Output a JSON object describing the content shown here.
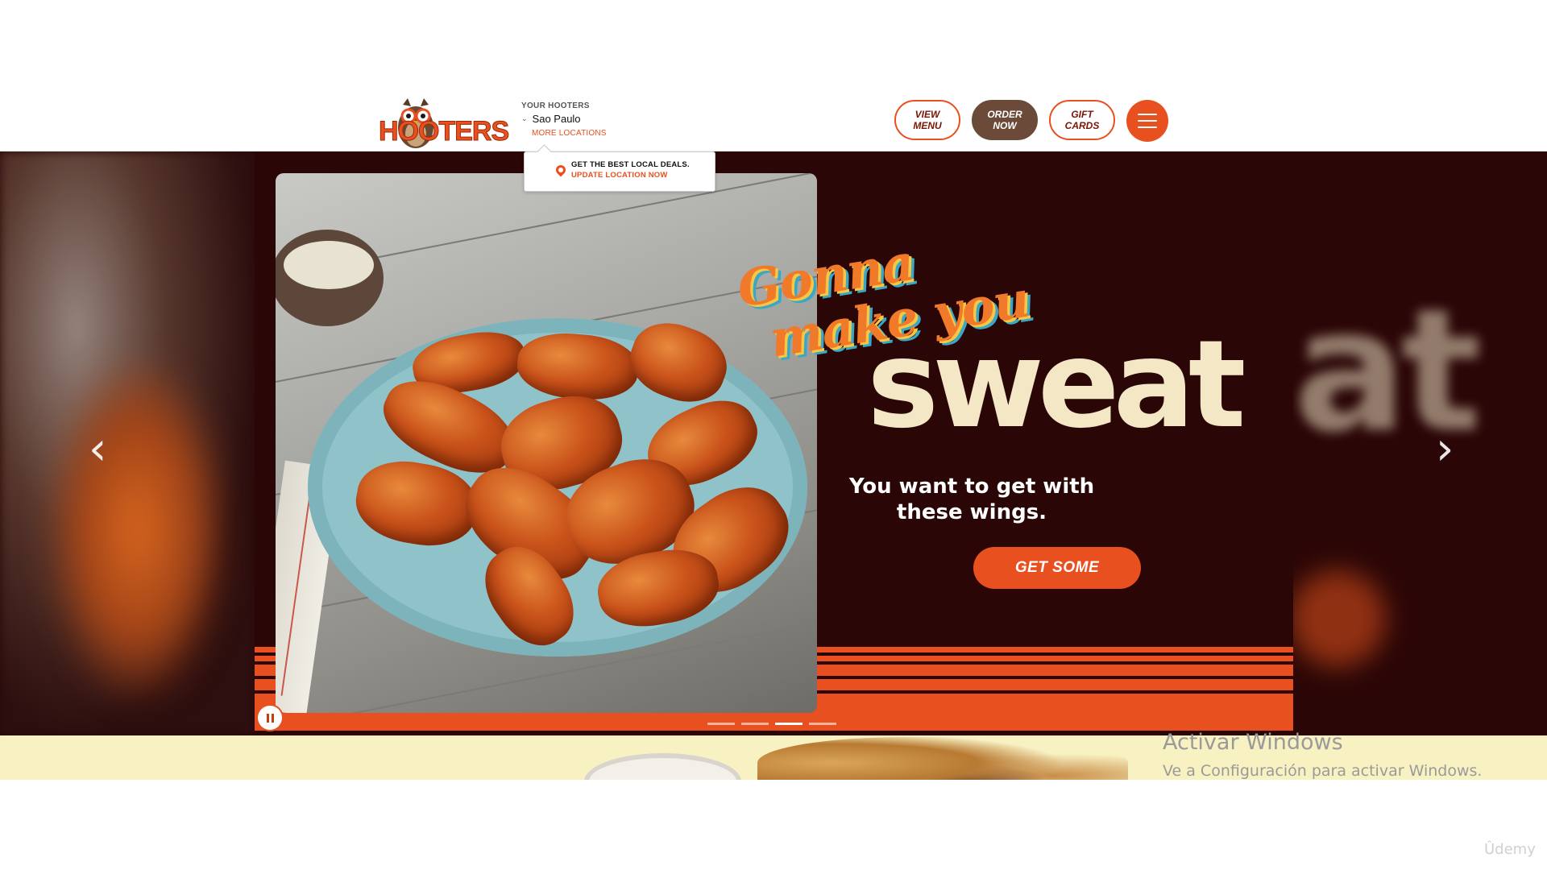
{
  "header": {
    "logo_text": "HOOTERS",
    "location": {
      "caption": "YOUR HOOTERS",
      "city": "Sao Paulo",
      "more_link": "MORE LOCATIONS"
    },
    "nav": {
      "view_menu": "VIEW MENU",
      "order_now": "ORDER NOW",
      "gift_cards": "GIFT CARDS"
    },
    "menu_icon": "hamburger-icon"
  },
  "popup": {
    "line1": "GET THE BEST LOCAL DEALS.",
    "line2": "UPDATE LOCATION NOW",
    "icon": "map-pin-icon"
  },
  "slide": {
    "headline_1": "Gonna",
    "headline_2": "make you",
    "headline_3": "sweat",
    "subtext": "You want to get with these wings.",
    "cta": "GET SOME",
    "ghost_text": "at",
    "dots": {
      "count": 4,
      "active_index": 2
    }
  },
  "controls": {
    "prev_icon": "chevron-left-icon",
    "next_icon": "chevron-right-icon",
    "pause_icon": "pause-icon",
    "prev_glyph": "‹",
    "next_glyph": "›"
  },
  "windows_watermark": {
    "title": "Activar Windows",
    "subtitle": "Ve a Configuración para activar Windows."
  },
  "udemy_watermark": "Ûdemy",
  "colors": {
    "brand_orange": "#e8501f",
    "dark_maroon": "#2a0606",
    "cream": "#f4e7c5",
    "order_brown": "#6b4a3a",
    "bottom_strip": "#f8f1c2"
  }
}
